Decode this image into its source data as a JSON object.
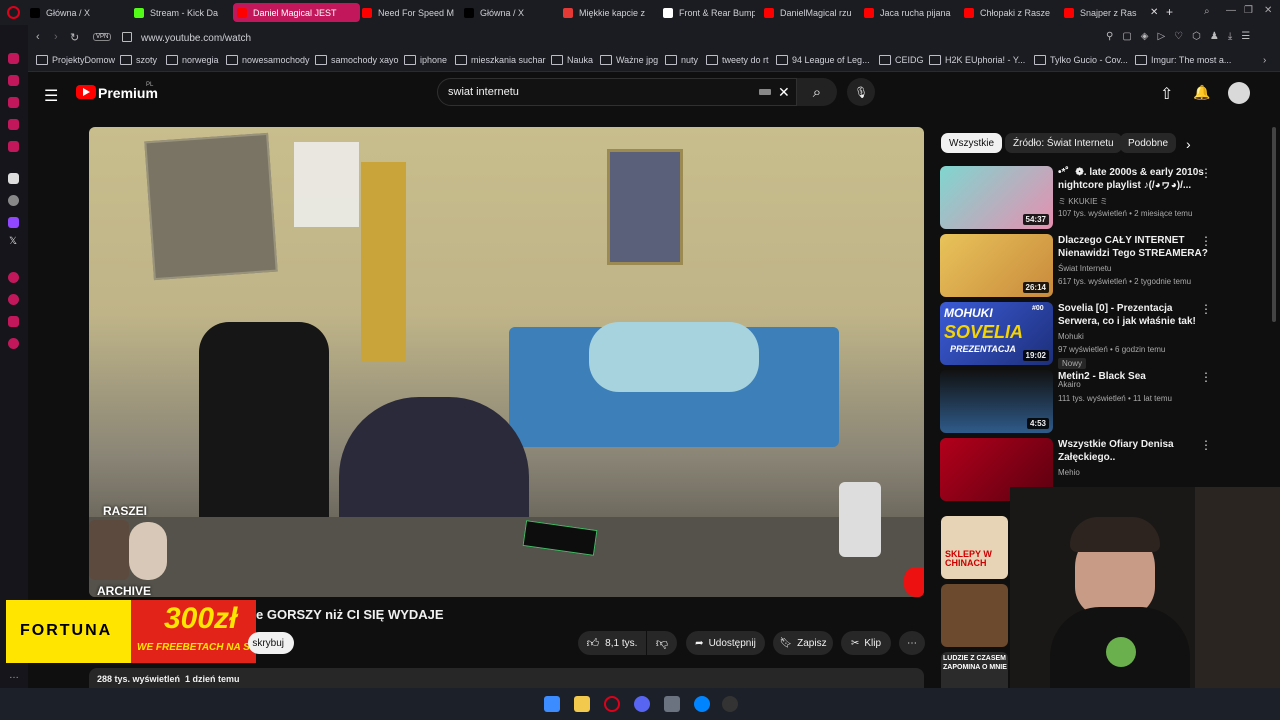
{
  "browser": {
    "tabs": [
      {
        "label": "Główna / X",
        "color": "#000000"
      },
      {
        "label": "Stream - Kick Da",
        "color": "#53fc18"
      },
      {
        "label": "Daniel Magical JEST",
        "color": "#ff0000"
      },
      {
        "label": "Need For Speed M",
        "color": "#ff0000"
      },
      {
        "label": "Główna / X",
        "color": "#000000"
      },
      {
        "label": "Miękkie kapcie z",
        "color": "#e53935"
      },
      {
        "label": "Front & Rear Bump",
        "color": "#ffffff"
      },
      {
        "label": "DanielMagical rzu",
        "color": "#ff0000"
      },
      {
        "label": "Jaca rucha pijana",
        "color": "#ff0000"
      },
      {
        "label": "Chłopaki z Rasze",
        "color": "#ff0000"
      },
      {
        "label": "Snajper z Ras",
        "color": "#ff0000"
      }
    ],
    "url": "www.youtube.com/watch",
    "vpn_label": "VPN",
    "bookmarks": [
      "ProjektyDomow",
      "szoty",
      "norwegia",
      "nowesamochody",
      "samochody xayo",
      "iphone",
      "mieszkania suchar",
      "Nauka",
      "Ważne jpg",
      "nuty",
      "tweety do rt",
      "94 League of Leg...",
      "CEIDG",
      "H2K EUphoria! - Y...",
      "Tylko Gucio - Cov...",
      "Imgur: The most a..."
    ]
  },
  "youtube": {
    "logo": "Premium",
    "logo_region": "PL",
    "search_value": "swiat internetu",
    "chips": [
      "Wszystkie",
      "Źródło: Świat Internetu",
      "Podobne"
    ],
    "video": {
      "title_visible": "e GORSZY niż CI SIĘ WYDAJE",
      "subscribe_partial": "skrybuj",
      "likes": "8,1 tys.",
      "share": "Udostępnij",
      "save": "Zapisz",
      "clip": "Klip",
      "views_line": "288 tys. wyświetleń  1 dzień temu"
    },
    "overlay": {
      "channel_name": "RASZEI",
      "channel_sub": "ARCHIVE",
      "ad_brand": "FORTUNA",
      "ad_amount": "300zł",
      "ad_sub": "WE FREEBETACH NA START"
    },
    "recommendations": [
      {
        "title": "•*゜❁. late 2000s & early 2010s nightcore playlist ♪(/◕ヮ◕)/...",
        "channel": "ミ KKUKIE ミ",
        "meta": "107 tys. wyświetleń • 2 miesiące temu",
        "duration": "54:37",
        "badge": ""
      },
      {
        "title": "Dlaczego CAŁY INTERNET Nienawidzi Tego STREAMERA?",
        "channel": "Świat Internetu",
        "meta": "617 tys. wyświetleń • 2 tygodnie temu",
        "duration": "26:14",
        "badge": ""
      },
      {
        "title": "Sovelia [0] - Prezentacja Serwera, co i jak właśnie tak!",
        "channel": "Mohuki",
        "meta": "97 wyświetleń • 6 godzin temu",
        "duration": "19:02",
        "badge": "Nowy"
      },
      {
        "title": "Metin2 - Black Sea",
        "channel": "Akairo",
        "meta": "111 tys. wyświetleń • 11 lat temu",
        "duration": "4:53",
        "badge": ""
      },
      {
        "title": "Wszystkie Ofiary Denisa Załęckiego..",
        "channel": "Mehio",
        "meta": "",
        "duration": "",
        "badge": ""
      }
    ],
    "thumb_texts": [
      "MOHUKI",
      "SOVELIA",
      "PREZENTACJA",
      "#00",
      "SKLEPY W CHINACH",
      "LUDZIE Z CZASEM ZAPOMINA O MNIE"
    ]
  },
  "colors": {
    "yt_red": "#ff0000",
    "tab_active": "#c2185b",
    "fortuna_yellow": "#ffe500",
    "fortuna_red": "#e2231a"
  }
}
